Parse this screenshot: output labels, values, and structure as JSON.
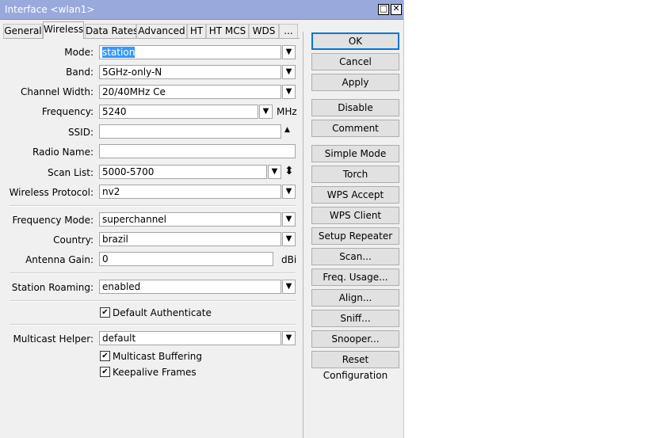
{
  "window": {
    "title": "Interface <wlan1>",
    "maximize_glyph": "□",
    "close_glyph": "✕"
  },
  "tabs": [
    "General",
    "Wireless",
    "Data Rates",
    "Advanced",
    "HT",
    "HT MCS",
    "WDS",
    "..."
  ],
  "active_tab": "Wireless",
  "fields": {
    "mode": {
      "label": "Mode:",
      "value": "station"
    },
    "band": {
      "label": "Band:",
      "value": "5GHz-only-N"
    },
    "channel_width": {
      "label": "Channel Width:",
      "value": "20/40MHz Ce"
    },
    "frequency": {
      "label": "Frequency:",
      "value": "5240",
      "unit": "MHz"
    },
    "ssid": {
      "label": "SSID:",
      "value": ""
    },
    "radio_name": {
      "label": "Radio Name:",
      "value": ""
    },
    "scan_list": {
      "label": "Scan List:",
      "value": "5000-5700"
    },
    "wireless_protocol": {
      "label": "Wireless Protocol:",
      "value": "nv2"
    },
    "frequency_mode": {
      "label": "Frequency Mode:",
      "value": "superchannel"
    },
    "country": {
      "label": "Country:",
      "value": "brazil"
    },
    "antenna_gain": {
      "label": "Antenna Gain:",
      "value": "0",
      "unit": "dBi"
    },
    "station_roaming": {
      "label": "Station Roaming:",
      "value": "enabled"
    },
    "multicast_helper": {
      "label": "Multicast Helper:",
      "value": "default"
    }
  },
  "checkboxes": {
    "default_authenticate": {
      "label": "Default Authenticate",
      "checked": true
    },
    "multicast_buffering": {
      "label": "Multicast Buffering",
      "checked": true
    },
    "keepalive_frames": {
      "label": "Keepalive Frames",
      "checked": true
    }
  },
  "buttons": {
    "ok": "OK",
    "cancel": "Cancel",
    "apply": "Apply",
    "disable": "Disable",
    "comment": "Comment",
    "simple_mode": "Simple Mode",
    "torch": "Torch",
    "wps_accept": "WPS Accept",
    "wps_client": "WPS Client",
    "setup_repeater": "Setup Repeater",
    "scan": "Scan...",
    "freq_usage": "Freq. Usage...",
    "align": "Align...",
    "sniff": "Sniff...",
    "snooper": "Snooper...",
    "reset_configuration": "Reset Configuration"
  },
  "glyphs": {
    "dropdown": "▼",
    "check": "✔",
    "up": "▲",
    "updown": "⬍"
  }
}
